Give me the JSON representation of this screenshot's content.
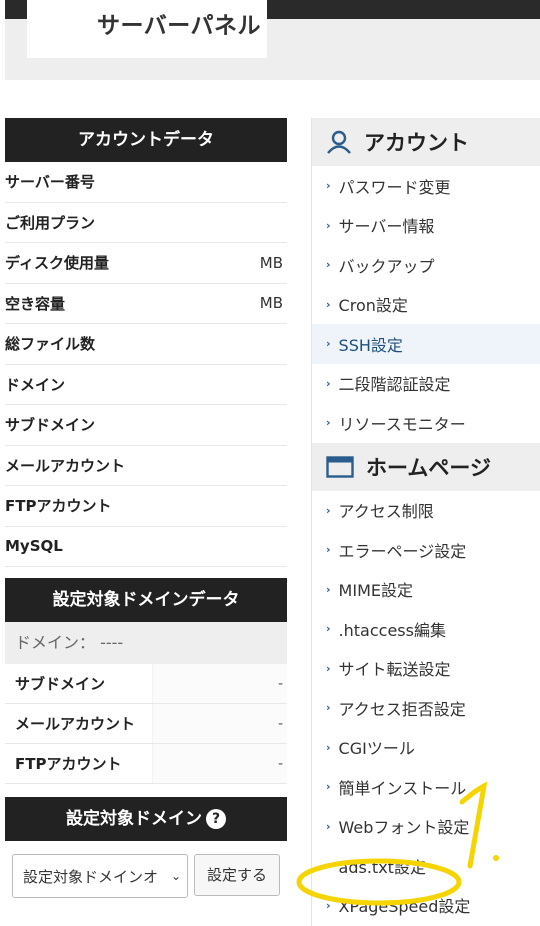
{
  "header": {
    "title": "サーバーパネル"
  },
  "account_panel": {
    "title": "アカウントデータ",
    "rows": [
      {
        "label": "サーバー番号",
        "value": ""
      },
      {
        "label": "ご利用プラン",
        "value": ""
      },
      {
        "label": "ディスク使用量",
        "value": "MB"
      },
      {
        "label": "空き容量",
        "value": "MB"
      },
      {
        "label": "総ファイル数",
        "value": ""
      },
      {
        "label": "ドメイン",
        "value": ""
      },
      {
        "label": "サブドメイン",
        "value": ""
      },
      {
        "label": "メールアカウント",
        "value": ""
      },
      {
        "label": "FTPアカウント",
        "value": ""
      },
      {
        "label": "MySQL",
        "value": ""
      }
    ]
  },
  "domain_panel": {
    "title": "設定対象ドメインデータ",
    "domain_line": "ドメイン： ----",
    "rows": [
      {
        "label": "サブドメイン",
        "value": "-"
      },
      {
        "label": "メールアカウント",
        "value": "-"
      },
      {
        "label": "FTPアカウント",
        "value": "-"
      }
    ]
  },
  "target_domain": {
    "title": "設定対象ドメイン",
    "help": "?",
    "select_value": "設定対象ドメインオ",
    "set_button": "設定する"
  },
  "menu": {
    "account": {
      "title": "アカウント",
      "items": [
        "パスワード変更",
        "サーバー情報",
        "バックアップ",
        "Cron設定",
        "SSH設定",
        "二段階認証設定",
        "リソースモニター"
      ],
      "active": "SSH設定"
    },
    "homepage": {
      "title": "ホームページ",
      "items": [
        "アクセス制限",
        "エラーページ設定",
        "MIME設定",
        ".htaccess編集",
        "サイト転送設定",
        "アクセス拒否設定",
        "CGIツール",
        "簡単インストール",
        "Webフォント設定",
        "ads.txt設定",
        "XPageSpeed設定"
      ]
    }
  },
  "annotation": {
    "label": "1.",
    "color": "#f5d400"
  },
  "colors": {
    "dark": "#222222",
    "accent": "#2a5c8e",
    "panel_bg": "#eeeeee"
  }
}
